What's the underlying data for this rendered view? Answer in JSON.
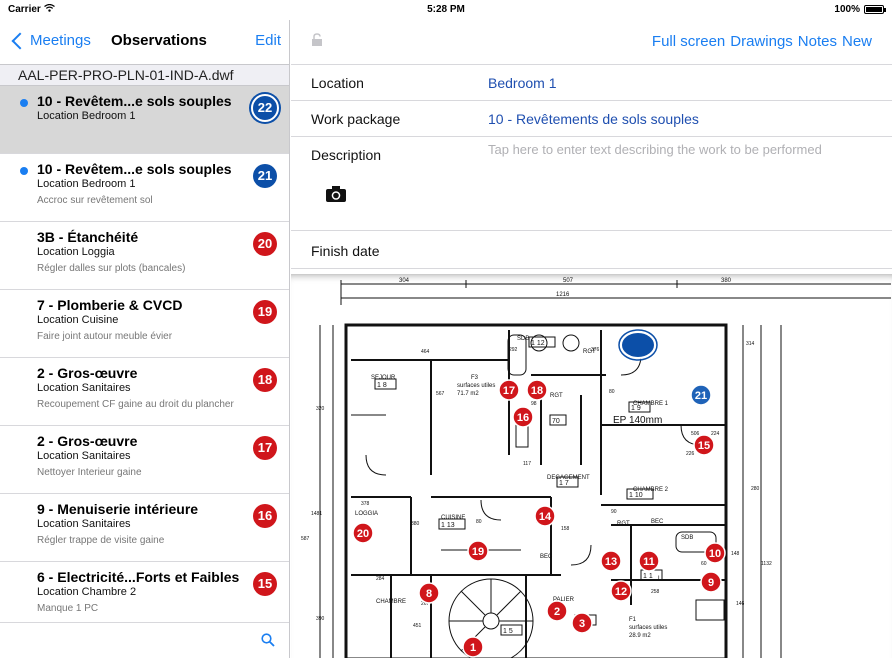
{
  "status_bar": {
    "carrier": "Carrier",
    "time": "5:28 PM",
    "battery": "100%"
  },
  "left_nav": {
    "back_label": "Meetings",
    "title": "Observations",
    "edit_label": "Edit"
  },
  "file_name": "AAL-PER-PRO-PLN-01-IND-A.dwf",
  "observations": [
    {
      "title": "10 - Revêtem...e sols souples",
      "location": "Location Bedroom 1",
      "note": "",
      "badge": "22",
      "unread": true,
      "selected": true,
      "color": "blue"
    },
    {
      "title": "10 - Revêtem...e sols souples",
      "location": "Location Bedroom 1",
      "note": "Accroc sur revêtement sol",
      "badge": "21",
      "unread": true,
      "selected": false,
      "color": "blue"
    },
    {
      "title": "3B - Étanchéité",
      "location": "Location Loggia",
      "note": "Régler dalles sur plots (bancales)",
      "badge": "20",
      "unread": false,
      "selected": false,
      "color": "red"
    },
    {
      "title": "7 - Plomberie & CVCD",
      "location": "Location Cuisine",
      "note": "Faire joint autour meuble évier",
      "badge": "19",
      "unread": false,
      "selected": false,
      "color": "red"
    },
    {
      "title": "2 - Gros-œuvre",
      "location": "Location Sanitaires",
      "note": "Recoupement CF gaine au droit du plancher",
      "badge": "18",
      "unread": false,
      "selected": false,
      "color": "red"
    },
    {
      "title": "2 - Gros-œuvre",
      "location": "Location Sanitaires",
      "note": "Nettoyer Interieur gaine",
      "badge": "17",
      "unread": false,
      "selected": false,
      "color": "red"
    },
    {
      "title": "9 - Menuiserie intérieure",
      "location": "Location Sanitaires",
      "note": "Régler trappe de visite gaine",
      "badge": "16",
      "unread": false,
      "selected": false,
      "color": "red"
    },
    {
      "title": "6 - Electricité...Forts et Faibles",
      "location": "Location Chambre 2",
      "note": "Manque 1 PC",
      "badge": "15",
      "unread": false,
      "selected": false,
      "color": "red"
    }
  ],
  "right_nav": {
    "full_screen": "Full screen",
    "drawings": "Drawings",
    "notes": "Notes",
    "new": "New"
  },
  "form": {
    "location_label": "Location",
    "location_value": "Bedroom 1",
    "work_package_label": "Work package",
    "work_package_value": "10 - Revêtements de sols souples",
    "description_label": "Description",
    "description_placeholder": "Tap here to enter text describing the work to be performed",
    "finish_date_label": "Finish date"
  },
  "drawing": {
    "dims_top": [
      "304",
      "507",
      "380"
    ],
    "dim_total": "1216",
    "dims_misc": [
      "292",
      "376",
      "464",
      "98",
      "117",
      "158",
      "62",
      "80",
      "126",
      "284",
      "90",
      "80",
      "380",
      "224",
      "148",
      "314",
      "320",
      "567",
      "506",
      "280",
      "1132",
      "1481",
      "378",
      "587",
      "390",
      "451",
      "267",
      "226",
      "146",
      "258",
      "60",
      "94"
    ],
    "room_labels": [
      "SEJOUR",
      "F3",
      "surfaces utiles",
      "71.7 m2",
      "SDB",
      "RGT",
      "CHAMBRE 1",
      "RGT",
      "WC",
      "DEGAGEMENT",
      "CHAMBRE 2",
      "LOGGIA",
      "CUISINE",
      "RGT",
      "BEC",
      "SDB",
      "LL",
      "CHAMBRE",
      "PALIER",
      "F1",
      "surfaces utiles",
      "28.9 m2",
      "BEC",
      "EP 140mm"
    ],
    "tags": [
      "1 12",
      "1 8",
      "1 9",
      "1 7",
      "1 10",
      "1 13",
      "1 3",
      "1 1",
      "70",
      "1 5"
    ],
    "markers": [
      {
        "n": "21",
        "color": "#1f63b8"
      },
      {
        "n": "17",
        "color": "#d0161b"
      },
      {
        "n": "18",
        "color": "#d0161b"
      },
      {
        "n": "16",
        "color": "#d0161b"
      },
      {
        "n": "15",
        "color": "#d0161b"
      },
      {
        "n": "20",
        "color": "#d0161b"
      },
      {
        "n": "14",
        "color": "#d0161b"
      },
      {
        "n": "19",
        "color": "#d0161b"
      },
      {
        "n": "13",
        "color": "#d0161b"
      },
      {
        "n": "11",
        "color": "#d0161b"
      },
      {
        "n": "10",
        "color": "#d0161b"
      },
      {
        "n": "9",
        "color": "#d0161b"
      },
      {
        "n": "12",
        "color": "#d0161b"
      },
      {
        "n": "8",
        "color": "#d0161b"
      },
      {
        "n": "2",
        "color": "#d0161b"
      },
      {
        "n": "3",
        "color": "#d0161b"
      },
      {
        "n": "1",
        "color": "#d0161b"
      }
    ]
  }
}
